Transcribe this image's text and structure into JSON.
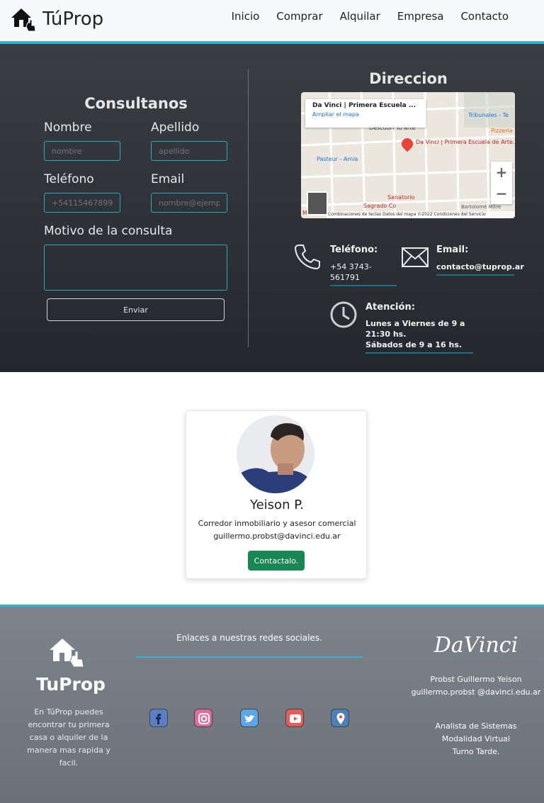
{
  "navbar": {
    "brand": "TúProp",
    "links": [
      "Inicio",
      "Comprar",
      "Alquilar",
      "Empresa",
      "Contacto"
    ]
  },
  "form": {
    "title": "Consultanos",
    "nombre_label": "Nombre",
    "nombre_placeholder": "nombre",
    "apellido_label": "Apellido",
    "apellido_placeholder": "apellido",
    "telefono_label": "Teléfono",
    "telefono_placeholder": "+54115467899",
    "email_label": "Email",
    "email_placeholder": "nombre@ejemplo.com",
    "motivo_label": "Motivo de la consulta",
    "submit_label": "Enviar"
  },
  "address": {
    "title": "Direccion",
    "map": {
      "card_title": "Da Vinci | Primera Escuela ...",
      "card_link": "Ampliar el mapa",
      "pin_label": "Da Vinci | Primera Escuela de Arte...",
      "labels": [
        "Tribunales - Te",
        "Pizzeria",
        "Descubrí Tu arte",
        "Pasteur - Amia",
        "Sanatorio",
        "Sagrado Co",
        "Mitre",
        "Bartolomé Mitre"
      ],
      "footer": "Combinaciones de teclas   Datos del mapa ©2022   Condiciones del Servicio",
      "zoom_in": "+",
      "zoom_out": "−"
    },
    "phone_label": "Teléfono:",
    "phone_value": "+54 3743-561791",
    "email_label": "Email:",
    "email_value": "contacto@tuprop.ar",
    "hours_label": "Atención:",
    "hours_line1": "Lunes a Viernes de 9 a",
    "hours_line2": "21:30 hs.",
    "hours_line3": "Sábados de 9 a 16 hs."
  },
  "profile": {
    "name": "Yeison P.",
    "role": "Corredor inmobiliario y asesor comercial",
    "email": "guillermo.probst@davinci.edu.ar",
    "button": "Contactalo."
  },
  "footer": {
    "brand": "TuProp",
    "description": "En TúProp puedes encontrar tu primera casa o alquiler de la manera mas rapida y facil.",
    "social_title": "Enlaces a nuestras redes sociales.",
    "social_icons": [
      "facebook-icon",
      "instagram-icon",
      "twitter-icon",
      "youtube-icon",
      "location-icon"
    ],
    "school_logo": "DaVinci",
    "person_name": "Probst Guillermo Yeison",
    "person_email": "guillermo.probst @davinci.edu.ar",
    "career_line1": "Analista de Sistemas",
    "career_line2": "Modalidad Virtual",
    "career_line3": "Turno Tarde."
  },
  "colors": {
    "accent": "#31b5cd",
    "button_success": "#198754"
  }
}
